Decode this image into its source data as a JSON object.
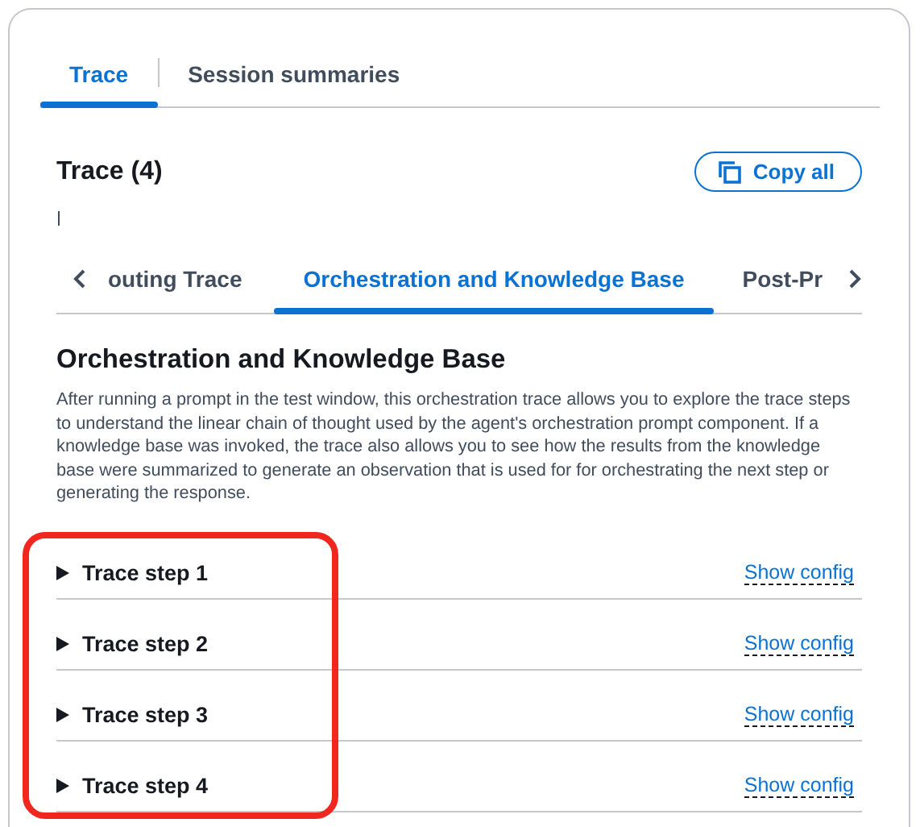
{
  "tabs": [
    {
      "label": "Trace",
      "selected": true
    },
    {
      "label": "Session summaries",
      "selected": false
    }
  ],
  "trace": {
    "title": "Trace (4)",
    "copy_button": "Copy all",
    "sub_tabs": [
      {
        "label": "outing Trace",
        "selected": false
      },
      {
        "label": "Orchestration and Knowledge Base",
        "selected": true
      },
      {
        "label": "Post-Pr",
        "selected": false
      }
    ],
    "section": {
      "title": "Orchestration and Knowledge Base",
      "description": "After running a prompt in the test window, this orchestration trace allows you to explore the trace steps to understand the linear chain of thought used by the agent's orchestration prompt component. If a knowledge base was invoked, the trace also allows you to see how the results from the knowledge base were summarized to generate an observation that is used for for orchestrating the next step or generating the response."
    },
    "steps": [
      {
        "label": "Trace step 1",
        "expanded": false,
        "link": "Show config"
      },
      {
        "label": "Trace step 2",
        "expanded": false,
        "link": "Show config"
      },
      {
        "label": "Trace step 3",
        "expanded": false,
        "link": "Show config"
      },
      {
        "label": "Trace step 4",
        "expanded": false,
        "link": "Show config"
      }
    ]
  }
}
